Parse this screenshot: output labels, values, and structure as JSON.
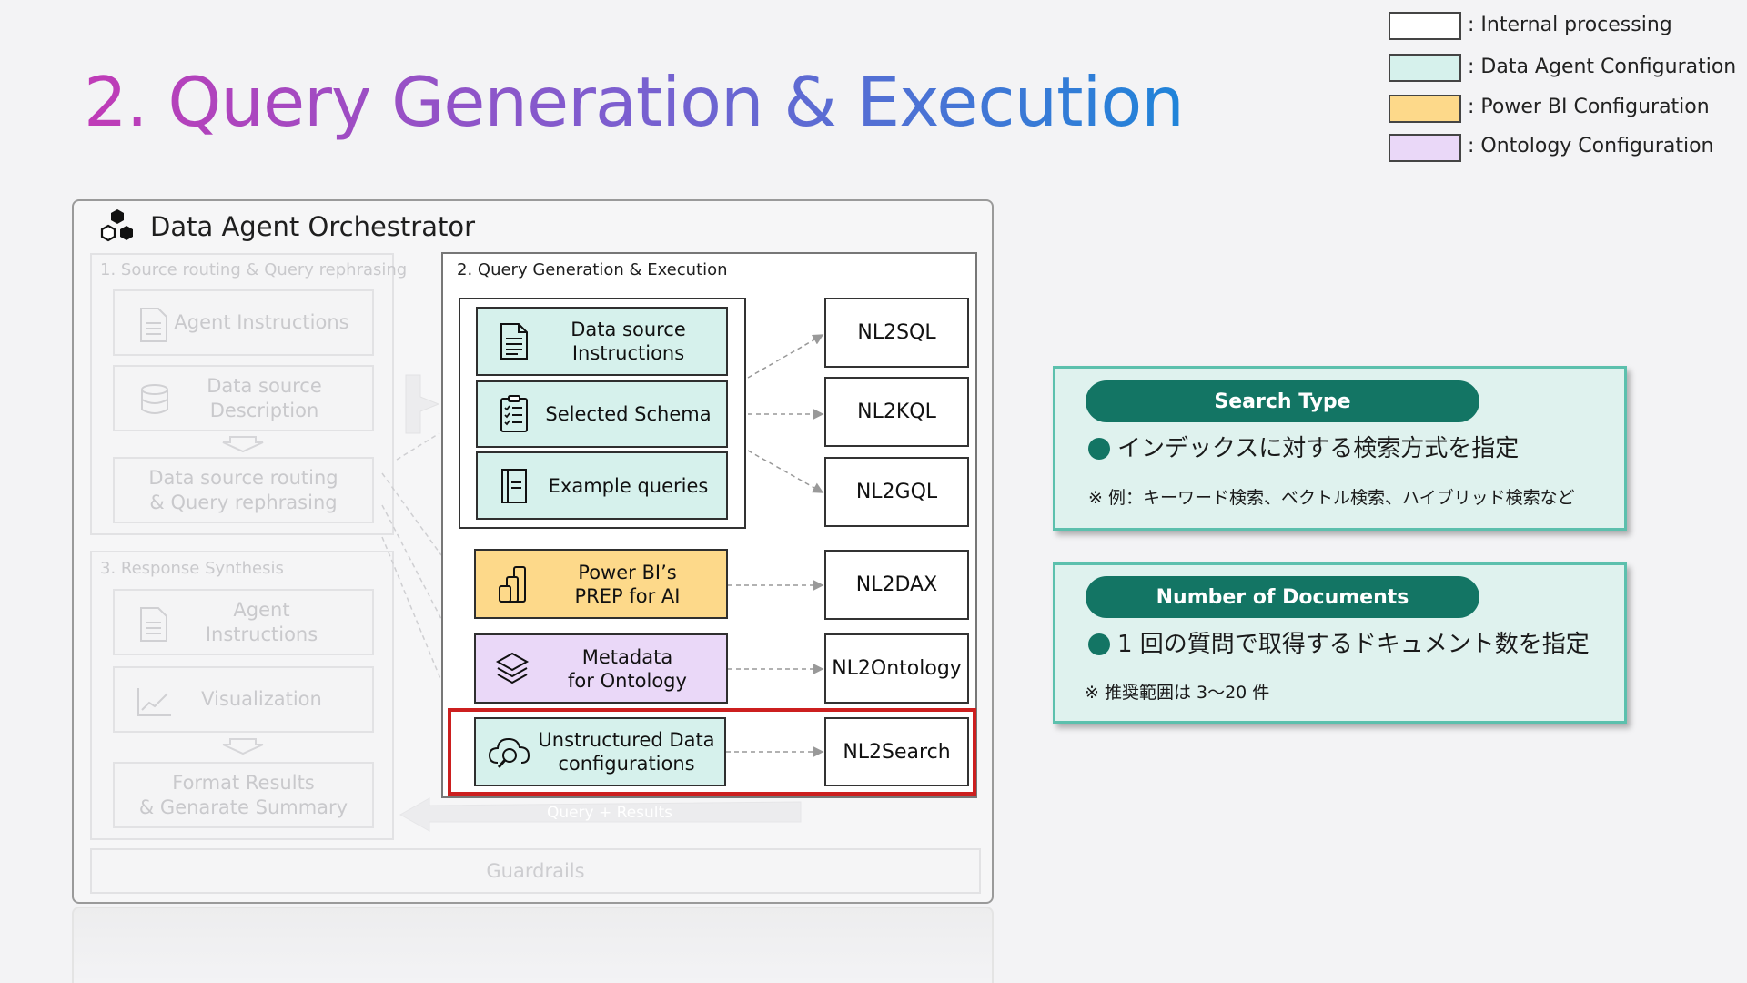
{
  "title": "2. Query Generation & Execution",
  "legend": [
    {
      "label": ": Internal processing",
      "color": "#ffffff"
    },
    {
      "label": ": Data Agent Configuration",
      "color": "#d6f1ec"
    },
    {
      "label": ": Power BI Configuration",
      "color": "#fdd98a"
    },
    {
      "label": ": Ontology Configuration",
      "color": "#ead8f8"
    }
  ],
  "orchestrator": {
    "title": "Data Agent Orchestrator",
    "icon": "hexagon-cluster-icon",
    "source_routing": {
      "label": "1. Source routing & Query rephrasing",
      "agent_instructions": "Agent Instructions",
      "data_source_description": "Data source Description",
      "routing": [
        "Data source routing",
        "& Query rephrasing"
      ]
    },
    "response_synthesis": {
      "label": "3. Response Synthesis",
      "agent_instructions": [
        "Agent",
        "Instructions"
      ],
      "visualization": "Visualization",
      "format_results": [
        "Format Results",
        "& Genarate Summary"
      ]
    },
    "query_results": "Query + Results",
    "guardrails": "Guardrails",
    "query_generation": {
      "label": "2. Query Generation & Execution",
      "configs": [
        {
          "lines": [
            "Data source",
            "Instructions"
          ],
          "icon": "document-icon",
          "type": "data-agent"
        },
        {
          "lines": [
            "Selected Schema"
          ],
          "icon": "checklist-icon",
          "type": "data-agent"
        },
        {
          "lines": [
            "Example queries"
          ],
          "icon": "page-icon",
          "type": "data-agent"
        },
        {
          "lines": [
            "Power BI’s",
            "PREP for AI"
          ],
          "icon": "power-bi-icon",
          "type": "power-bi"
        },
        {
          "lines": [
            "Metadata",
            "for Ontology"
          ],
          "icon": "layers-icon",
          "type": "ontology"
        },
        {
          "lines": [
            "Unstructured Data",
            "configurations"
          ],
          "icon": "cloud-search-icon",
          "type": "data-agent"
        }
      ],
      "engines": [
        "NL2SQL",
        "NL2KQL",
        "NL2GQL",
        "NL2DAX",
        "NL2Ontology",
        "NL2Search"
      ]
    }
  },
  "cards": [
    {
      "pill": "Search Type",
      "main": "インデックスに対する検索方式を指定",
      "note": "※ 例：キーワード検索、ベクトル検索、ハイブリッド検索など"
    },
    {
      "pill": "Number of Documents",
      "main": "1 回の質問で取得するドキュメント数を指定",
      "note": "※ 推奨範囲は 3〜20 件"
    }
  ],
  "colors": {
    "accent": "#137564",
    "highlight": "#cc1f1f",
    "card_border": "#5cc0ad"
  }
}
